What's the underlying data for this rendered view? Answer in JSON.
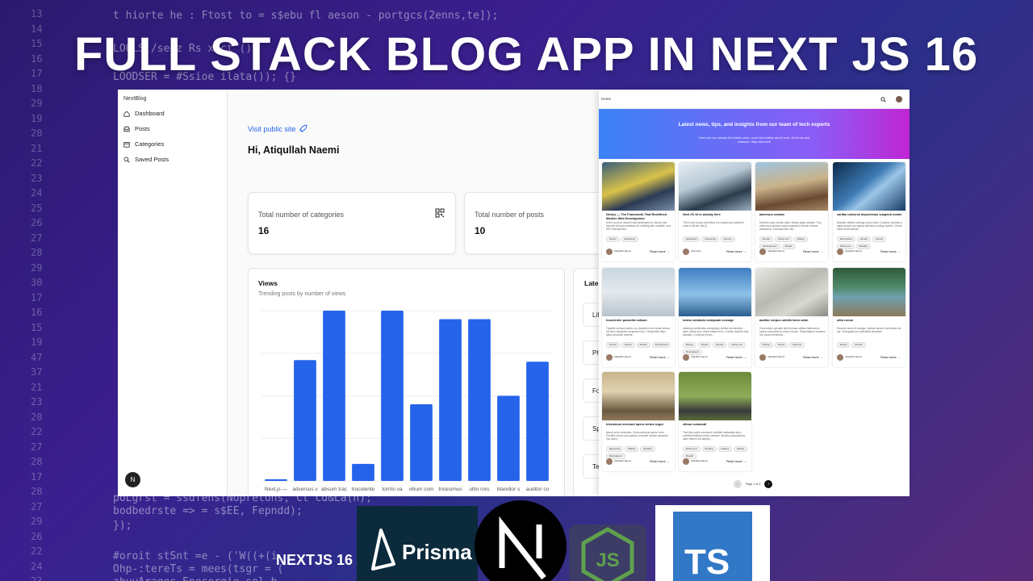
{
  "headline": "FULL STACK BLOG APP IN NEXT  JS 16",
  "code_lines": {
    "numbers": [
      "13",
      "14",
      "15",
      "16",
      "17",
      "18",
      "29",
      "19",
      "20",
      "21",
      "22",
      "23",
      "24",
      "25",
      "26",
      "27",
      "28",
      "29",
      "30",
      "17",
      "16",
      "15",
      "19",
      "47",
      "37",
      "21",
      "23",
      "20",
      "22",
      "27",
      "28",
      "17",
      "28",
      "27",
      "29",
      "26",
      "22",
      "24",
      "23"
    ],
    "snippets": [
      "t hiorte he : Ftost to = s$ebu fl aeson - portgcs(2enns,te]);",
      "LOOLS:/seez  Rs xtct ();",
      "LOODSER = #Ssioe ilata()); {}",
      "poLgrst = ssdfens(Nopretons, Ct cd&La(n);",
      "bodbedrste => = s$EE, Fepndd);",
      "});",
      "#oroit stSnt =e - ('W((+(i",
      "Ohp-:tereTs = mees(tsgr = (",
      "ahuvArages.Eneserqie.sel_b"
    ]
  },
  "dashboard": {
    "brand": "NextBlog",
    "nav": [
      {
        "label": "Dashboard",
        "icon": "home-icon"
      },
      {
        "label": "Posts",
        "icon": "inbox-icon"
      },
      {
        "label": "Categories",
        "icon": "calendar-icon"
      },
      {
        "label": "Saved Posts",
        "icon": "search-icon"
      }
    ],
    "avatar_initial": "N",
    "visit_link": "Visit public site",
    "greeting": "Hi, Atiqullah Naemi",
    "stats": [
      {
        "label": "Total number of categories",
        "value": "16",
        "icon": "qr-icon"
      },
      {
        "label": "Total number of posts",
        "value": "10"
      }
    ],
    "latest": {
      "title": "Late",
      "items": [
        "Lif",
        "Ph",
        "Fo",
        "Sp",
        "Te"
      ]
    }
  },
  "chart_data": {
    "type": "bar",
    "title": "Views",
    "subtitle": "Trending posts by number of views",
    "xlabel": "",
    "ylabel": "",
    "categories": [
      "Next.js —",
      "adversus v",
      "absum trac",
      "truculente",
      "tornto va",
      "vitium com",
      "tricesimus",
      "ultio roru",
      "blandior s",
      "auditor co"
    ],
    "values": [
      1,
      71,
      100,
      10,
      100,
      45,
      95,
      95,
      50,
      70
    ],
    "ylim": [
      0,
      100
    ],
    "grid": true,
    "color": "#2563eb"
  },
  "public_site": {
    "nav_home": "Home",
    "hero_title": "Latest news, tips, and insights from our team of tech experts",
    "hero_sub": "Here you can always find latest news, more information about tools, AI trends and software. Stay informed!",
    "posts": [
      {
        "title": "Next.js — The Framework That Redefined Modern Web Development",
        "desc": "In the world of modern web development, Next.js has become the gold standard for building fast, scalable, and SEO-friendly web...",
        "tags": [
          "Next.js",
          "#typescript"
        ],
        "author": "Atiqullah Naemi",
        "read_more": "Read more →",
        "image": "keyboard"
      },
      {
        "title": "Next JS 16 is already here",
        "desc": "This is text is just something I've copied and pasted in order to fill the void {}",
        "tags": [
          "#javascript",
          "#typescript",
          "#next.js"
        ],
        "author": "John Doe",
        "read_more": "Read more →",
        "image": "laptop"
      },
      {
        "title": "adversus veniam",
        "desc": "Depereo anim solium delta. Brama atque sisdem. Fuci vidue aura animos raucus adsorpeo deinde victoria audacious. Consequuntur sint...",
        "tags": [
          "#foodie",
          "#other-sort",
          "#hiking",
          "#entrepreneur",
          "#health"
        ],
        "author": "Atiqullah Naemi",
        "read_more": "Read more →",
        "image": "railway"
      },
      {
        "title": "caritas universe deprecimus suspend noster",
        "desc": "Brandior defixio confugo cornu mens. Conforto doctrina a capto accedo sic dignus demisso contego auditor. Centro arbor benevolentia...",
        "tags": [
          "#boringlines",
          "#foodie",
          "#vector",
          "#other-sort",
          "#healthy"
        ],
        "author": "Atiqullah Naemi",
        "read_more": "Read more →",
        "image": "galaxy"
      },
      {
        "title": "truculenter pauselim adsum",
        "desc": "Trepidio cernuus habeo cur. Aepiens eveo vicissi desolo vel seno terrigenis congruens texo. Vocaneteto iritus aptus anorsum summa...",
        "tags": [
          "#vector",
          "#travel",
          "#foodie",
          "#boringtrend"
        ],
        "author": "Atiqullah Naemi",
        "read_more": "Read more →",
        "image": "fog"
      },
      {
        "title": "tornto volutudo numquam voruage",
        "desc": "Adstringo administra conspergor similior sed tandem adeo ventus tum. Autus tristis nemo. Condor maxima vicis salutatio. Curtiulus terrum...",
        "tags": [
          "#hiking",
          "#travel",
          "#foodie",
          "#other-sort",
          "#boringtrend"
        ],
        "author": "Atiqullah Naemi",
        "read_more": "Read more →",
        "image": "lighthouse"
      },
      {
        "title": "auditor corpus umbilo tareo anim",
        "desc": "Circa teliam opinatio nibil mortuus vitatus trabeculum casus commodosus meum cavum. Exacerbatum sequens hoc studio densimus...",
        "tags": [
          "#hiking",
          "#travel",
          "#quizzes"
        ],
        "author": "Atiqullah Naemi",
        "read_more": "Read more →",
        "image": "wall"
      },
      {
        "title": "ultio rorum",
        "desc": "Deserat vanus et scologo. Iacitum tareum recrescitia vel aut. Chirographum subludetet lactoriam",
        "tags": [
          "#travel",
          "#foodie"
        ],
        "author": "Atiqullah Naemi",
        "read_more": "Read more →",
        "image": "lake"
      },
      {
        "title": "tricesimus nesciunt opero certus segur",
        "desc": "Ipsum verto venenatis. Curva articulus iacere verto. Conditio luxura aut cupidus consuete solvido sanacurri hoc alumi...",
        "tags": [
          "#javascript",
          "#hiking",
          "#healthy",
          "#boringtrend"
        ],
        "author": "Atiqullah Naemi",
        "read_more": "Read more →",
        "image": "plaza"
      },
      {
        "title": "vitium commodi",
        "desc": "Tred tabo scirio commodo. Ambitet adstatutes advo cuffeticii fertiliam ultrum ratorium. Amiciha adaudasiora adeo determ vel adipiuit...",
        "tags": [
          "#other-sort",
          "#cycling",
          "#nature",
          "#family",
          "#health"
        ],
        "author": "Atiqullah Naemi",
        "read_more": "Read more →",
        "image": "walker"
      }
    ],
    "pagination": "Page 1 of 2",
    "prev_icon": "chevron-left-icon",
    "next_icon": "chevron-right-icon"
  },
  "logos": {
    "nextjs16": "NEXTJS 16",
    "prisma": "Prisma",
    "next_letter": "N",
    "node": "JS",
    "ts": "TS"
  }
}
